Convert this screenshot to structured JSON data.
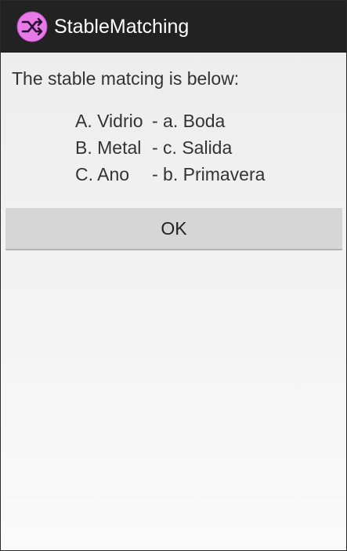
{
  "app": {
    "title": "StableMatching",
    "icon": "shuffle-icon",
    "colors": {
      "action_bar": "#222222",
      "icon_circle": "#e879e8",
      "button": "#d6d6d6"
    }
  },
  "content": {
    "intro": "The stable matcing is below:",
    "matches": [
      {
        "left": "A. Vidrio",
        "right": "- a. Boda"
      },
      {
        "left": "B. Metal",
        "right": "- c. Salida"
      },
      {
        "left": "C. Ano",
        "right": "- b. Primavera"
      }
    ]
  },
  "ok_button": {
    "label": "OK"
  }
}
